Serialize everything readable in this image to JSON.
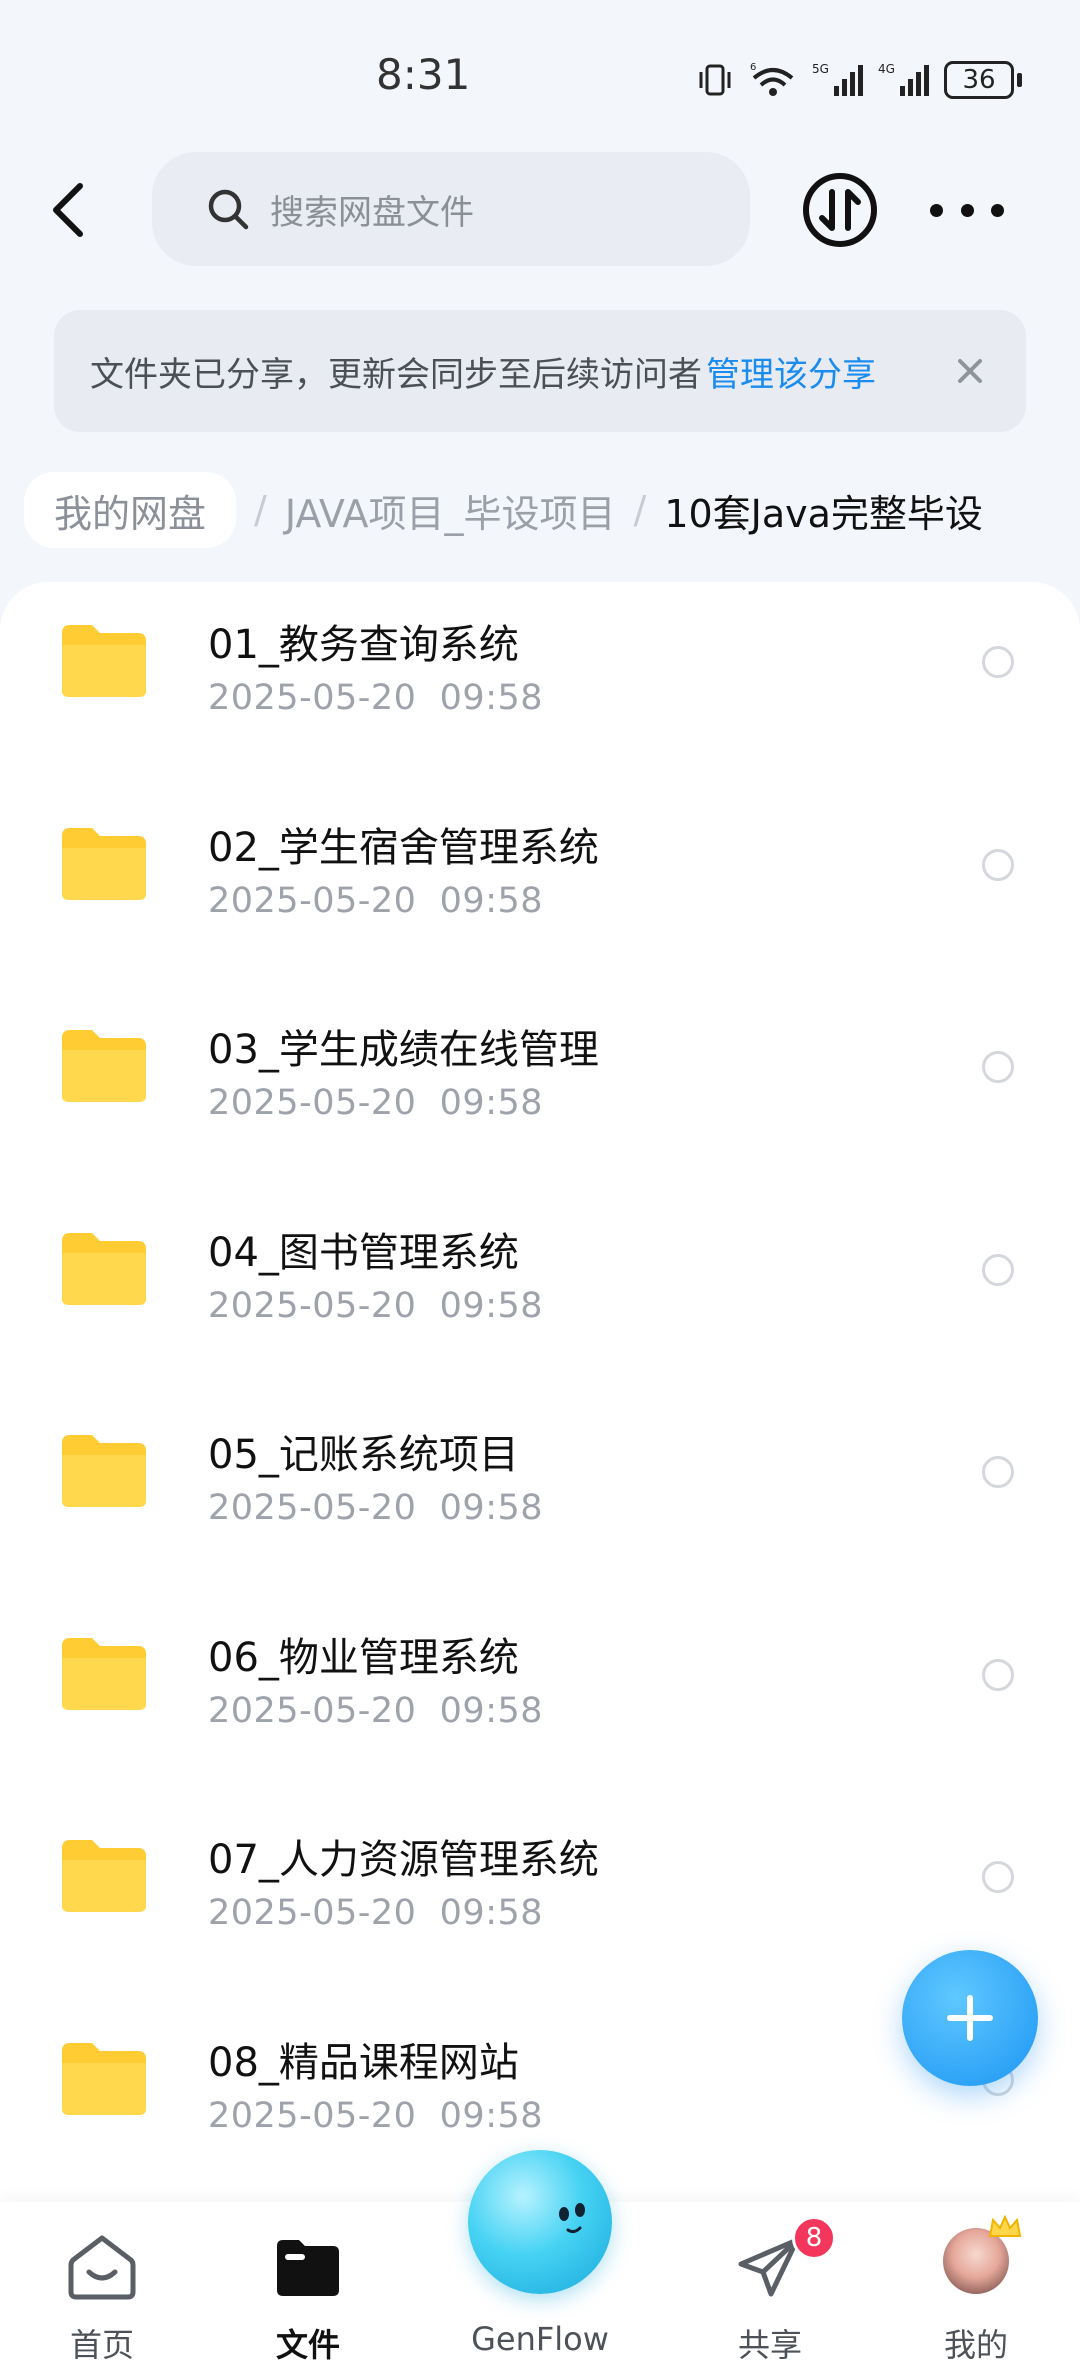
{
  "status_bar": {
    "time": "8:31",
    "battery": "36"
  },
  "search": {
    "placeholder": "搜索网盘文件"
  },
  "share_notice": {
    "text": "文件夹已分享，更新会同步至后续访问者",
    "link": "管理该分享"
  },
  "breadcrumb": {
    "root": "我的网盘",
    "parent": "JAVA项目_毕设项目",
    "current": "10套Java完整毕设"
  },
  "files": [
    {
      "name": "01_教务查询系统",
      "date": "2025-05-20  09:58"
    },
    {
      "name": "02_学生宿舍管理系统",
      "date": "2025-05-20  09:58"
    },
    {
      "name": "03_学生成绩在线管理",
      "date": "2025-05-20  09:58"
    },
    {
      "name": "04_图书管理系统",
      "date": "2025-05-20  09:58"
    },
    {
      "name": "05_记账系统项目",
      "date": "2025-05-20  09:58"
    },
    {
      "name": "06_物业管理系统",
      "date": "2025-05-20  09:58"
    },
    {
      "name": "07_人力资源管理系统",
      "date": "2025-05-20  09:58"
    },
    {
      "name": "08_精品课程网站",
      "date": "2025-05-20  09:58"
    }
  ],
  "nav": {
    "home": "首页",
    "files": "文件",
    "genflow": "GenFlow",
    "share": "共享",
    "share_badge": "8",
    "me": "我的"
  },
  "colors": {
    "accent": "#1a8cf0",
    "folder": "#ffcc33",
    "badge": "#f5365c"
  },
  "icons": [
    "back-arrow-icon",
    "search-icon",
    "transfer-icon",
    "more-icon",
    "close-icon",
    "folder-icon",
    "plus-icon",
    "home-icon",
    "folder-nav-icon",
    "paper-plane-icon"
  ]
}
